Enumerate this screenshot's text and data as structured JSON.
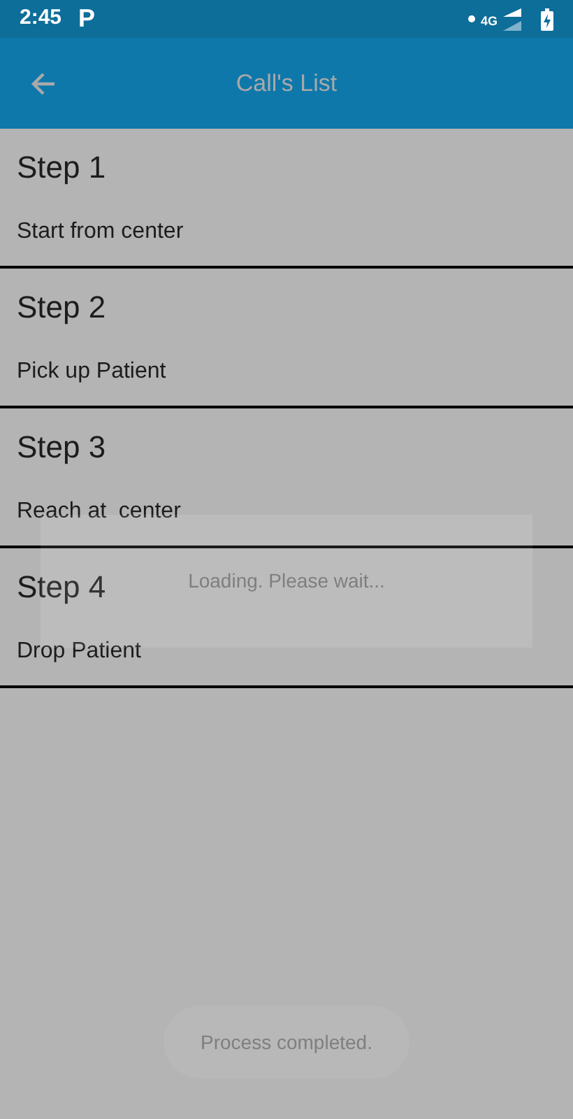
{
  "status_bar": {
    "time": "2:45",
    "notification": "P",
    "network": "4G"
  },
  "app_bar": {
    "title": "Call's List"
  },
  "steps": [
    {
      "title": "Step 1",
      "description": "Start from center"
    },
    {
      "title": "Step 2",
      "description": "Pick up Patient"
    },
    {
      "title": "Step 3",
      "description": "Reach at  center"
    },
    {
      "title": "Step 4",
      "description": "Drop Patient"
    }
  ],
  "loading_dialog": {
    "message": "Loading. Please wait..."
  },
  "toast": {
    "message": "Process completed."
  }
}
